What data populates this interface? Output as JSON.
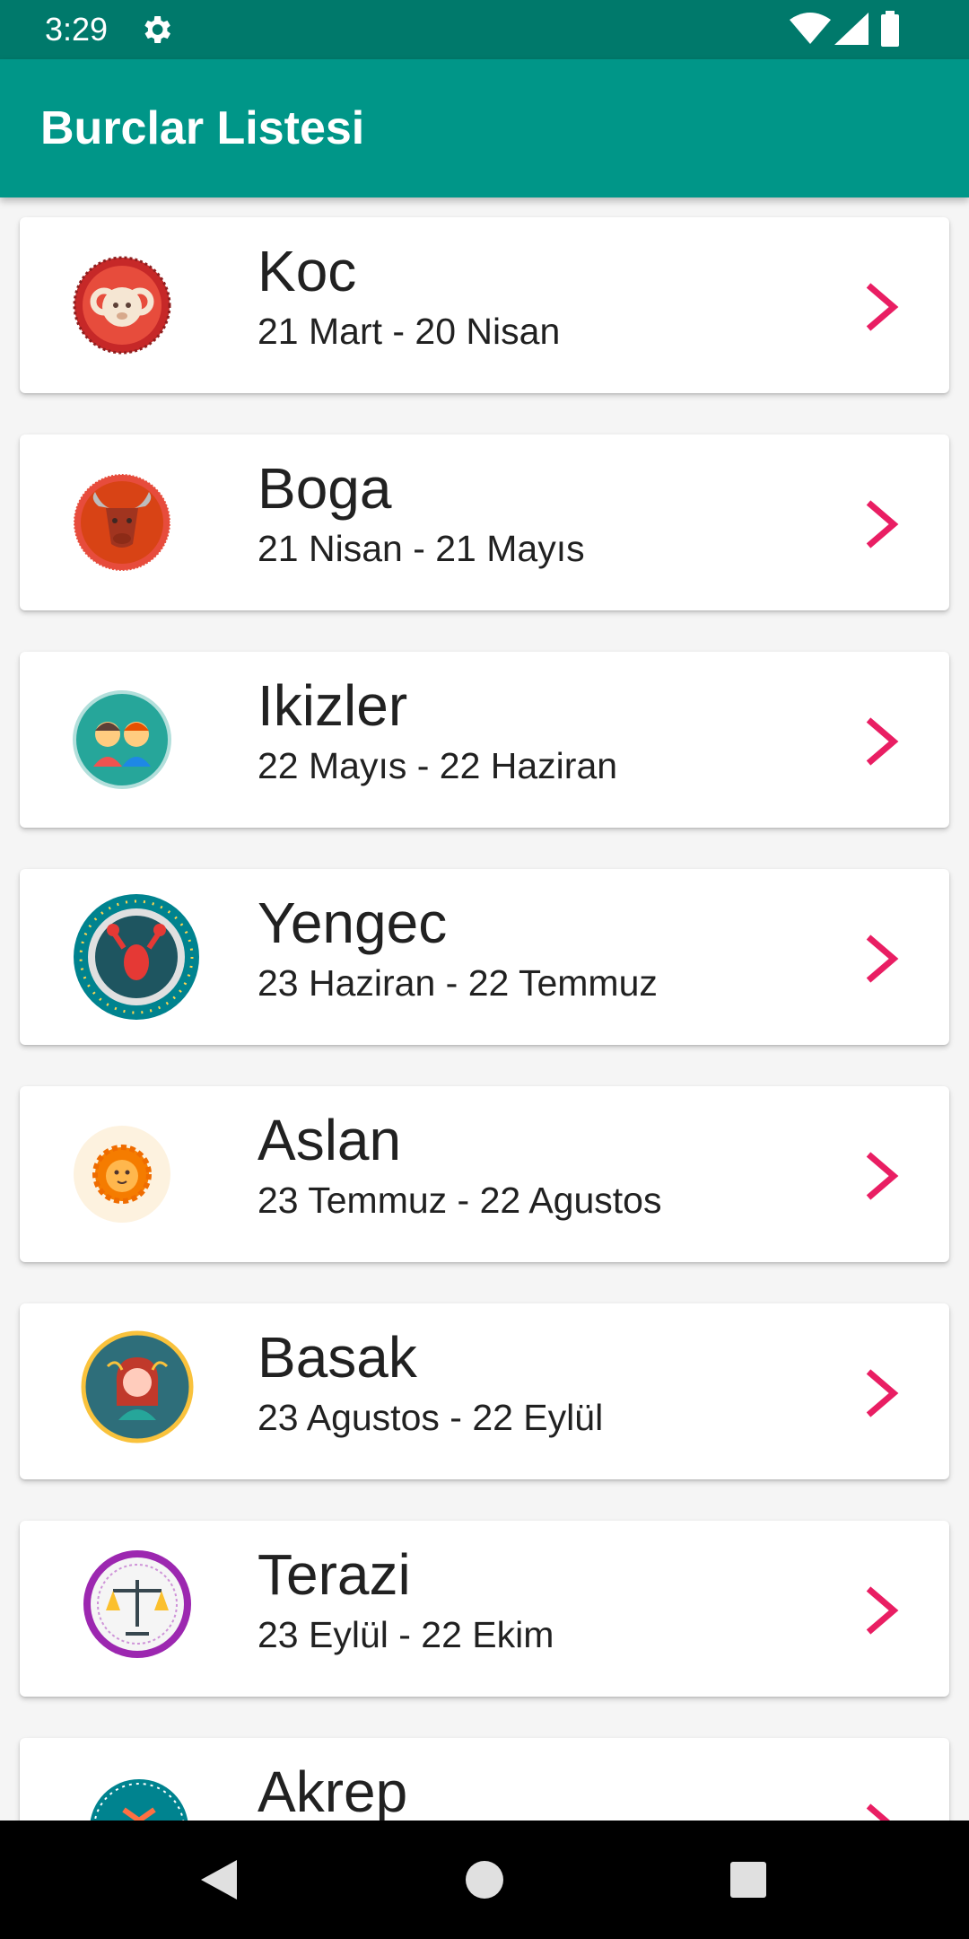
{
  "status_bar": {
    "time": "3:29",
    "icons": [
      "gear-icon",
      "wifi-icon",
      "cellular-icon",
      "battery-icon"
    ],
    "color": "#00796b"
  },
  "app_bar": {
    "title": "Burclar Listesi",
    "color": "#009688"
  },
  "accent_color": "#e91e63",
  "zodiac_list": [
    {
      "name": "Koc",
      "dates": "21 Mart - 20 Nisan",
      "icon": "ram-icon"
    },
    {
      "name": "Boga",
      "dates": "21 Nisan - 21 Mayıs",
      "icon": "bull-icon"
    },
    {
      "name": "Ikizler",
      "dates": "22 Mayıs - 22 Haziran",
      "icon": "twins-icon"
    },
    {
      "name": "Yengec",
      "dates": "23 Haziran - 22 Temmuz",
      "icon": "crab-icon"
    },
    {
      "name": "Aslan",
      "dates": "23 Temmuz - 22 Agustos",
      "icon": "lion-icon"
    },
    {
      "name": "Basak",
      "dates": "23 Agustos - 22 Eylül",
      "icon": "virgin-icon"
    },
    {
      "name": "Terazi",
      "dates": "23 Eylül - 22 Ekim",
      "icon": "scales-icon"
    },
    {
      "name": "Akrep",
      "dates": "",
      "icon": "scorpion-icon"
    }
  ],
  "nav_bar": {
    "icons": [
      "back-icon",
      "home-icon",
      "recents-icon"
    ]
  }
}
